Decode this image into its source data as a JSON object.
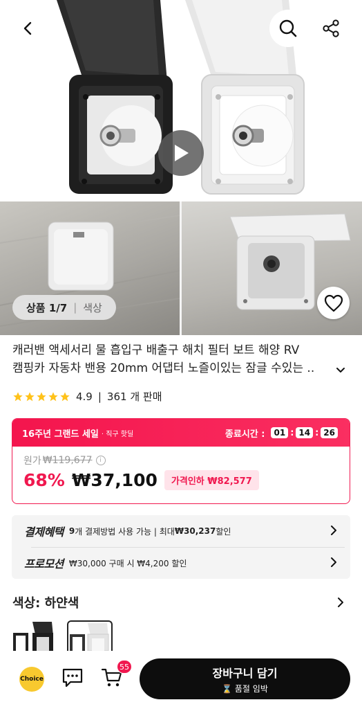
{
  "nav": {
    "back_icon": "chevron-left-icon",
    "search_icon": "search-icon",
    "share_icon": "share-icon"
  },
  "gallery": {
    "play_icon": "play-icon",
    "counter_main": "상품 1/7",
    "counter_sub": "색상",
    "wishlist_icon": "heart-icon"
  },
  "product": {
    "title_line1": "캐러밴 액세서리 물 흡입구 배출구 해치 필터 보트 해양 RV",
    "title_line2": "캠핑카 자동차 밴용 20mm 어댑터 노즐이있는 잠글 수있는 ..",
    "rating": "4.9",
    "sold": "361 개 판매",
    "star_count": 5
  },
  "sale": {
    "banner": "16주년 그랜드 세일",
    "banner_tag": "· 직구 핫딜",
    "ends_label": "종료시간 :",
    "timer": [
      "01",
      "14",
      "26"
    ],
    "orig_label": "원가",
    "orig_price": "₩119,677",
    "discount": "68%",
    "price": "₩37,100",
    "price_drop": "가격인하 ₩82,577"
  },
  "benefits": [
    {
      "label": "결제혜택",
      "prefix": "9",
      "text": "개 결제방법 사용 가능 | 최대 ",
      "bold": "₩30,237",
      "suffix": " 할인"
    },
    {
      "label": "프로모션",
      "prefix": "",
      "text": "₩30,000 구매 시 ₩4,200 할인",
      "bold": "",
      "suffix": ""
    }
  ],
  "color": {
    "title": "색상: 하얀색"
  },
  "bottom": {
    "choice_label": "Choice",
    "cart_badge": "55",
    "cart_button_line1": "장바구니 담기",
    "cart_button_line2": "품절 임박"
  },
  "colors": {
    "accent": "#f0184f",
    "rating_star": "#ffc21a",
    "choice_bg": "#f8c92f"
  }
}
